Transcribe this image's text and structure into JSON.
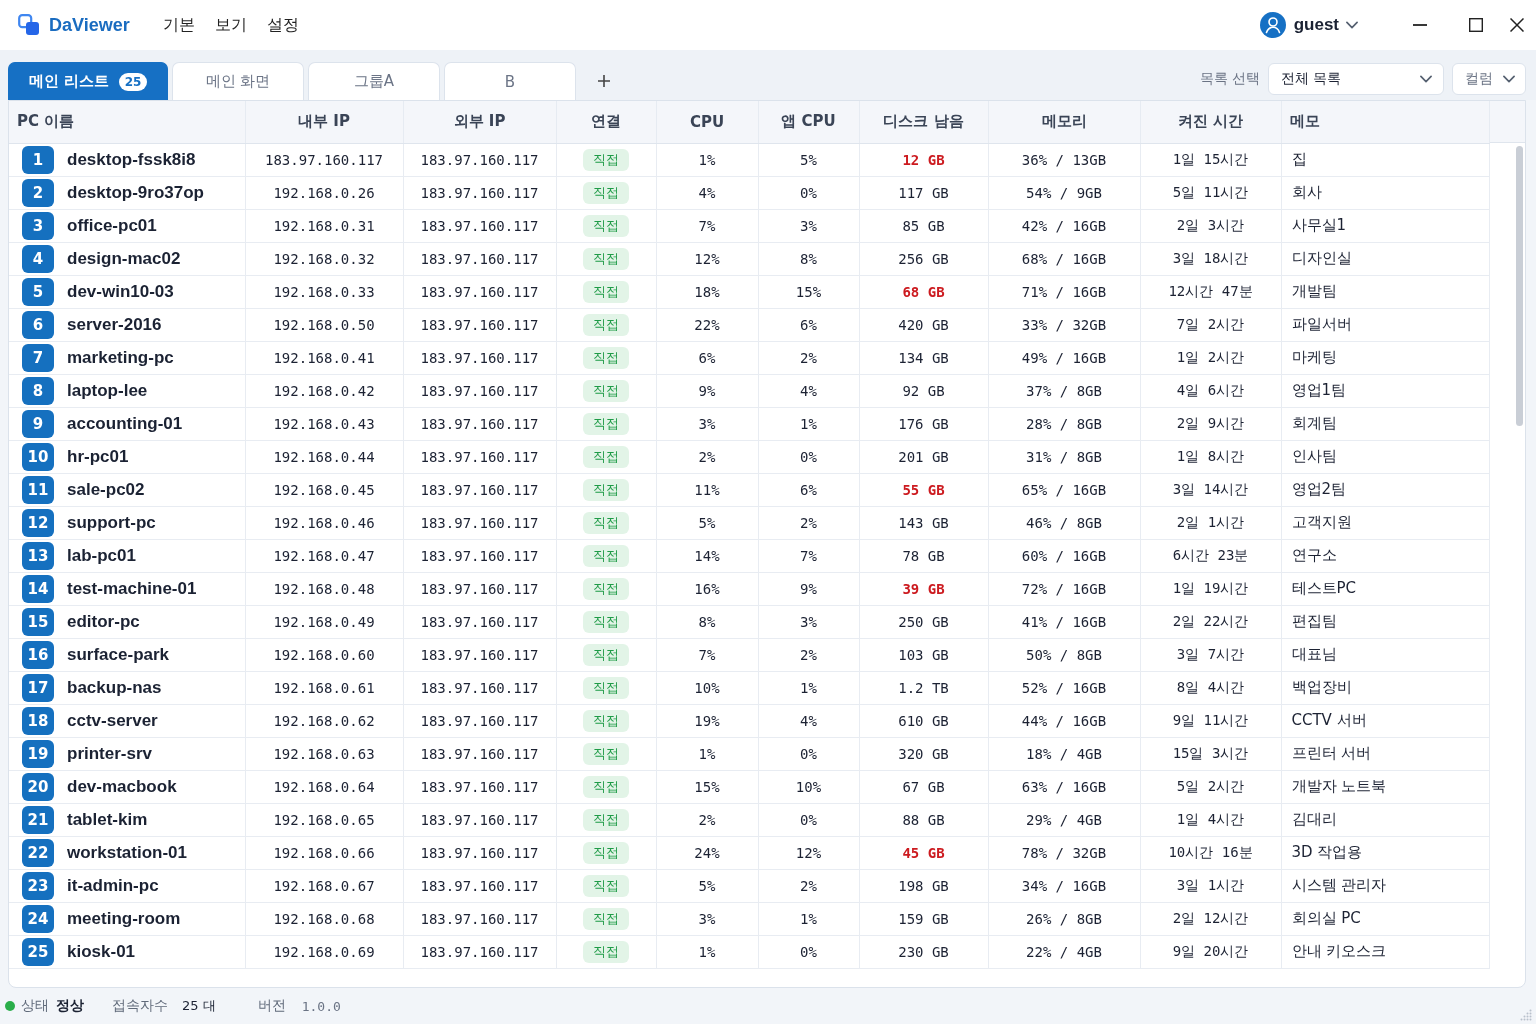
{
  "window": {
    "app_name": "DaViewer",
    "menu": [
      "기본",
      "보기",
      "설정"
    ],
    "user": "guest"
  },
  "tabs": [
    {
      "label": "메인 리스트",
      "badge": "25",
      "selected": true
    },
    {
      "label": "메인 화면",
      "selected": false
    },
    {
      "label": "그룹A",
      "selected": false
    },
    {
      "label": "B",
      "selected": false
    }
  ],
  "list_selector": {
    "label": "목록 선택",
    "value": "전체 목록"
  },
  "columns_button": {
    "label": "컬럼"
  },
  "table": {
    "columns": [
      "PC 이름",
      "내부 IP",
      "외부 IP",
      "연결",
      "CPU",
      "앱 CPU",
      "디스크 남음",
      "메모리",
      "켜진 시간",
      "메모"
    ],
    "rows": [
      {
        "number": "1",
        "pc_name": "desktop-fssk8i8",
        "internal_ip": "183.97.160.117",
        "external_ip": "183.97.160.117",
        "connection": "직접",
        "cpu": "1%",
        "app_cpu": "5%",
        "disk_free": "12 GB",
        "disk_low": true,
        "memory": "36% / 13GB",
        "uptime": "1일 15시간",
        "memo": "집"
      },
      {
        "number": "2",
        "pc_name": "desktop-9ro37op",
        "internal_ip": "192.168.0.26",
        "external_ip": "183.97.160.117",
        "connection": "직접",
        "cpu": "4%",
        "app_cpu": "0%",
        "disk_free": "117 GB",
        "disk_low": false,
        "memory": "54% / 9GB",
        "uptime": "5일 11시간",
        "memo": "회사"
      },
      {
        "number": "3",
        "pc_name": "office-pc01",
        "internal_ip": "192.168.0.31",
        "external_ip": "183.97.160.117",
        "connection": "직접",
        "cpu": "7%",
        "app_cpu": "3%",
        "disk_free": "85 GB",
        "disk_low": false,
        "memory": "42% / 16GB",
        "uptime": "2일 3시간",
        "memo": "사무실1"
      },
      {
        "number": "4",
        "pc_name": "design-mac02",
        "internal_ip": "192.168.0.32",
        "external_ip": "183.97.160.117",
        "connection": "직접",
        "cpu": "12%",
        "app_cpu": "8%",
        "disk_free": "256 GB",
        "disk_low": false,
        "memory": "68% / 16GB",
        "uptime": "3일 18시간",
        "memo": "디자인실"
      },
      {
        "number": "5",
        "pc_name": "dev-win10-03",
        "internal_ip": "192.168.0.33",
        "external_ip": "183.97.160.117",
        "connection": "직접",
        "cpu": "18%",
        "app_cpu": "15%",
        "disk_free": "68 GB",
        "disk_low": true,
        "memory": "71% / 16GB",
        "uptime": "12시간 47분",
        "memo": "개발팀"
      },
      {
        "number": "6",
        "pc_name": "server-2016",
        "internal_ip": "192.168.0.50",
        "external_ip": "183.97.160.117",
        "connection": "직접",
        "cpu": "22%",
        "app_cpu": "6%",
        "disk_free": "420 GB",
        "disk_low": false,
        "memory": "33% / 32GB",
        "uptime": "7일 2시간",
        "memo": "파일서버"
      },
      {
        "number": "7",
        "pc_name": "marketing-pc",
        "internal_ip": "192.168.0.41",
        "external_ip": "183.97.160.117",
        "connection": "직접",
        "cpu": "6%",
        "app_cpu": "2%",
        "disk_free": "134 GB",
        "disk_low": false,
        "memory": "49% / 16GB",
        "uptime": "1일 2시간",
        "memo": "마케팅"
      },
      {
        "number": "8",
        "pc_name": "laptop-lee",
        "internal_ip": "192.168.0.42",
        "external_ip": "183.97.160.117",
        "connection": "직접",
        "cpu": "9%",
        "app_cpu": "4%",
        "disk_free": "92 GB",
        "disk_low": false,
        "memory": "37% / 8GB",
        "uptime": "4일 6시간",
        "memo": "영업1팀"
      },
      {
        "number": "9",
        "pc_name": "accounting-01",
        "internal_ip": "192.168.0.43",
        "external_ip": "183.97.160.117",
        "connection": "직접",
        "cpu": "3%",
        "app_cpu": "1%",
        "disk_free": "176 GB",
        "disk_low": false,
        "memory": "28% / 8GB",
        "uptime": "2일 9시간",
        "memo": "회계팀"
      },
      {
        "number": "10",
        "pc_name": "hr-pc01",
        "internal_ip": "192.168.0.44",
        "external_ip": "183.97.160.117",
        "connection": "직접",
        "cpu": "2%",
        "app_cpu": "0%",
        "disk_free": "201 GB",
        "disk_low": false,
        "memory": "31% / 8GB",
        "uptime": "1일 8시간",
        "memo": "인사팀"
      },
      {
        "number": "11",
        "pc_name": "sale-pc02",
        "internal_ip": "192.168.0.45",
        "external_ip": "183.97.160.117",
        "connection": "직접",
        "cpu": "11%",
        "app_cpu": "6%",
        "disk_free": "55 GB",
        "disk_low": true,
        "memory": "65% / 16GB",
        "uptime": "3일 14시간",
        "memo": "영업2팀"
      },
      {
        "number": "12",
        "pc_name": "support-pc",
        "internal_ip": "192.168.0.46",
        "external_ip": "183.97.160.117",
        "connection": "직접",
        "cpu": "5%",
        "app_cpu": "2%",
        "disk_free": "143 GB",
        "disk_low": false,
        "memory": "46% / 8GB",
        "uptime": "2일 1시간",
        "memo": "고객지원"
      },
      {
        "number": "13",
        "pc_name": "lab-pc01",
        "internal_ip": "192.168.0.47",
        "external_ip": "183.97.160.117",
        "connection": "직접",
        "cpu": "14%",
        "app_cpu": "7%",
        "disk_free": "78 GB",
        "disk_low": false,
        "memory": "60% / 16GB",
        "uptime": "6시간 23분",
        "memo": "연구소"
      },
      {
        "number": "14",
        "pc_name": "test-machine-01",
        "internal_ip": "192.168.0.48",
        "external_ip": "183.97.160.117",
        "connection": "직접",
        "cpu": "16%",
        "app_cpu": "9%",
        "disk_free": "39 GB",
        "disk_low": true,
        "memory": "72% / 16GB",
        "uptime": "1일 19시간",
        "memo": "테스트PC"
      },
      {
        "number": "15",
        "pc_name": "editor-pc",
        "internal_ip": "192.168.0.49",
        "external_ip": "183.97.160.117",
        "connection": "직접",
        "cpu": "8%",
        "app_cpu": "3%",
        "disk_free": "250 GB",
        "disk_low": false,
        "memory": "41% / 16GB",
        "uptime": "2일 22시간",
        "memo": "편집팀"
      },
      {
        "number": "16",
        "pc_name": "surface-park",
        "internal_ip": "192.168.0.60",
        "external_ip": "183.97.160.117",
        "connection": "직접",
        "cpu": "7%",
        "app_cpu": "2%",
        "disk_free": "103 GB",
        "disk_low": false,
        "memory": "50% / 8GB",
        "uptime": "3일 7시간",
        "memo": "대표님"
      },
      {
        "number": "17",
        "pc_name": "backup-nas",
        "internal_ip": "192.168.0.61",
        "external_ip": "183.97.160.117",
        "connection": "직접",
        "cpu": "10%",
        "app_cpu": "1%",
        "disk_free": "1.2 TB",
        "disk_low": false,
        "memory": "52% / 16GB",
        "uptime": "8일 4시간",
        "memo": "백업장비"
      },
      {
        "number": "18",
        "pc_name": "cctv-server",
        "internal_ip": "192.168.0.62",
        "external_ip": "183.97.160.117",
        "connection": "직접",
        "cpu": "19%",
        "app_cpu": "4%",
        "disk_free": "610 GB",
        "disk_low": false,
        "memory": "44% / 16GB",
        "uptime": "9일 11시간",
        "memo": "CCTV 서버"
      },
      {
        "number": "19",
        "pc_name": "printer-srv",
        "internal_ip": "192.168.0.63",
        "external_ip": "183.97.160.117",
        "connection": "직접",
        "cpu": "1%",
        "app_cpu": "0%",
        "disk_free": "320 GB",
        "disk_low": false,
        "memory": "18% / 4GB",
        "uptime": "15일 3시간",
        "memo": "프린터 서버"
      },
      {
        "number": "20",
        "pc_name": "dev-macbook",
        "internal_ip": "192.168.0.64",
        "external_ip": "183.97.160.117",
        "connection": "직접",
        "cpu": "15%",
        "app_cpu": "10%",
        "disk_free": "67 GB",
        "disk_low": false,
        "memory": "63% / 16GB",
        "uptime": "5일 2시간",
        "memo": "개발자 노트북"
      },
      {
        "number": "21",
        "pc_name": "tablet-kim",
        "internal_ip": "192.168.0.65",
        "external_ip": "183.97.160.117",
        "connection": "직접",
        "cpu": "2%",
        "app_cpu": "0%",
        "disk_free": "88 GB",
        "disk_low": false,
        "memory": "29% / 4GB",
        "uptime": "1일 4시간",
        "memo": "김대리"
      },
      {
        "number": "22",
        "pc_name": "workstation-01",
        "internal_ip": "192.168.0.66",
        "external_ip": "183.97.160.117",
        "connection": "직접",
        "cpu": "24%",
        "app_cpu": "12%",
        "disk_free": "45 GB",
        "disk_low": true,
        "memory": "78% / 32GB",
        "uptime": "10시간 16분",
        "memo": "3D 작업용"
      },
      {
        "number": "23",
        "pc_name": "it-admin-pc",
        "internal_ip": "192.168.0.67",
        "external_ip": "183.97.160.117",
        "connection": "직접",
        "cpu": "5%",
        "app_cpu": "2%",
        "disk_free": "198 GB",
        "disk_low": false,
        "memory": "34% / 16GB",
        "uptime": "3일 1시간",
        "memo": "시스템 관리자"
      },
      {
        "number": "24",
        "pc_name": "meeting-room",
        "internal_ip": "192.168.0.68",
        "external_ip": "183.97.160.117",
        "connection": "직접",
        "cpu": "3%",
        "app_cpu": "1%",
        "disk_free": "159 GB",
        "disk_low": false,
        "memory": "26% / 8GB",
        "uptime": "2일 12시간",
        "memo": "회의실 PC"
      },
      {
        "number": "25",
        "pc_name": "kiosk-01",
        "internal_ip": "192.168.0.69",
        "external_ip": "183.97.160.117",
        "connection": "직접",
        "cpu": "1%",
        "app_cpu": "0%",
        "disk_free": "230 GB",
        "disk_low": false,
        "memory": "22% / 4GB",
        "uptime": "9일 20시간",
        "memo": "안내 키오스크"
      }
    ]
  },
  "status_bar": {
    "status_label": "상태",
    "status_value": "정상",
    "users_label": "접속자수",
    "users_value": "25 대",
    "version_label": "버전",
    "version_value": "1.0.0"
  }
}
